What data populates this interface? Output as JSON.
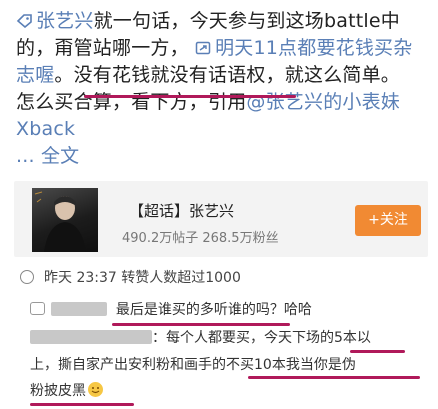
{
  "post": {
    "line1_mention": "张艺兴",
    "line1_text": "就一句话，今天参与到这场battle中",
    "line2_text": "的，甭管站哪一方，",
    "line2_link": "明天11点都要花钱买杂",
    "line3_link": "志喔",
    "line3_text": "。没有花钱就没有话语权，就这么简单。",
    "line4_text": "怎么买合算，看下方，引用",
    "line4_mention": "@张艺兴的小表妹",
    "line5_mention": "Xback",
    "line6_more": "... 全文"
  },
  "card": {
    "title": "【超话】张艺兴",
    "stats": "490.2万帖子 268.5万粉丝",
    "follow_button": "+关注"
  },
  "meta": {
    "time_label": "昨天 23:37 转赞人数超过1000"
  },
  "comments": {
    "c1_text": "最后是谁买的多听谁的吗？哈哈",
    "c2_text": "：每个人都要买，今天下场的5本以",
    "c3_text": "上，撕自家产出安利粉和画手的不买10本我当你是伪",
    "c4_text": "粉披皮黑"
  },
  "colors": {
    "link": "#5a7fb6",
    "underline": "#b0195a",
    "follow_button": "#f18a33",
    "card_bg": "#f3f3f3"
  },
  "icons": [
    "super-topic-tag-icon",
    "link-icon",
    "clock-icon",
    "reply-icon",
    "smile-emoji-icon"
  ]
}
